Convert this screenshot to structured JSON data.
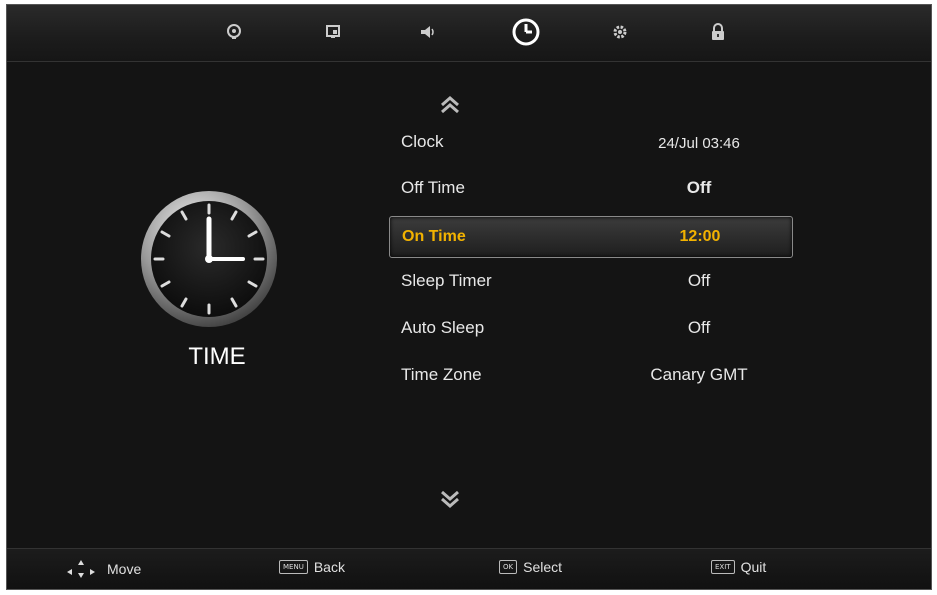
{
  "top_icons": [
    {
      "name": "picture-icon",
      "active": false
    },
    {
      "name": "screen-icon",
      "active": false
    },
    {
      "name": "sound-icon",
      "active": false
    },
    {
      "name": "clock-icon",
      "active": true
    },
    {
      "name": "setup-gear-icon",
      "active": false
    },
    {
      "name": "lock-icon",
      "active": false
    }
  ],
  "section": {
    "title": "TIME"
  },
  "menu": [
    {
      "label": "Clock",
      "value": "24/Jul  03:46"
    },
    {
      "label": "Off Time",
      "value": "Off"
    },
    {
      "label": "On Time",
      "value": "12:00",
      "selected": true
    },
    {
      "label": "Sleep Timer",
      "value": "Off"
    },
    {
      "label": "Auto Sleep",
      "value": "Off"
    },
    {
      "label": "Time Zone",
      "value": "Canary GMT"
    }
  ],
  "footer": {
    "move": {
      "label": "Move"
    },
    "back": {
      "key": "MENU",
      "label": "Back"
    },
    "select": {
      "key": "OK",
      "label": "Select"
    },
    "quit": {
      "key": "EXIT",
      "label": "Quit"
    }
  },
  "colors": {
    "accent": "#f2b200",
    "background": "#141414"
  }
}
